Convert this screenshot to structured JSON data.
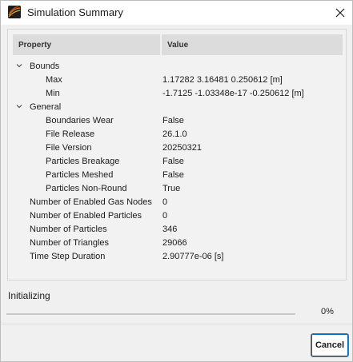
{
  "window": {
    "title": "Simulation Summary",
    "app_icon": "app-logo-icon",
    "close_icon": "close-icon"
  },
  "grid": {
    "columns": [
      "Property",
      "Value"
    ],
    "groups": {
      "bounds": {
        "label": "Bounds",
        "items": [
          {
            "name": "Max",
            "value": "1.17282 3.16481 0.250612 [m]"
          },
          {
            "name": "Min",
            "value": "-1.7125 -1.03348e-17 -0.250612 [m]"
          }
        ]
      },
      "general": {
        "label": "General",
        "items": [
          {
            "name": "Boundaries Wear",
            "value": "False"
          },
          {
            "name": "File Release",
            "value": "26.1.0"
          },
          {
            "name": "File Version",
            "value": "20250321"
          },
          {
            "name": "Particles Breakage",
            "value": "False"
          },
          {
            "name": "Particles Meshed",
            "value": "False"
          },
          {
            "name": "Particles Non-Round",
            "value": "True"
          }
        ]
      }
    },
    "top_level": [
      {
        "name": "Number of Enabled Gas Nodes",
        "value": "0"
      },
      {
        "name": "Number of Enabled Particles",
        "value": "0"
      },
      {
        "name": "Number of Particles",
        "value": "346"
      },
      {
        "name": "Number of Triangles",
        "value": "29066"
      },
      {
        "name": "Time Step Duration",
        "value": "2.90777e-06 [s]"
      }
    ]
  },
  "status": {
    "text": "Initializing",
    "progress": 0,
    "percent_label": "0%"
  },
  "footer": {
    "cancel_label": "Cancel"
  },
  "colors": {
    "accent": "#0067c0",
    "header_bg": "#dcdcdc",
    "panel_bg": "#f2f2f2"
  }
}
